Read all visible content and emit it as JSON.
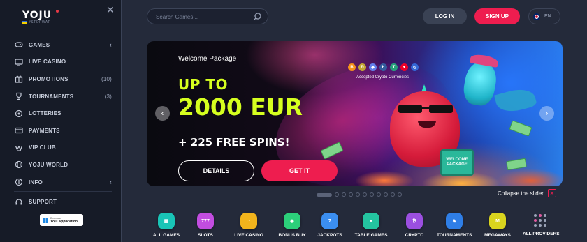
{
  "logo": {
    "name": "YOJU",
    "tagline": "#STOPWAR"
  },
  "sidebar": {
    "items": [
      {
        "label": "GAMES",
        "count": "",
        "chevron": "‹",
        "icon": "games-icon"
      },
      {
        "label": "LIVE CASINO",
        "count": "",
        "chevron": "",
        "icon": "live-casino-icon"
      },
      {
        "label": "PROMOTIONS",
        "count": "(10)",
        "chevron": "",
        "icon": "promotions-icon"
      },
      {
        "label": "TOURNAMENTS",
        "count": "(3)",
        "chevron": "",
        "icon": "tournaments-icon"
      },
      {
        "label": "LOTTERIES",
        "count": "",
        "chevron": "",
        "icon": "lotteries-icon"
      },
      {
        "label": "PAYMENTS",
        "count": "",
        "chevron": "",
        "icon": "payments-icon"
      },
      {
        "label": "VIP CLUB",
        "count": "",
        "chevron": "",
        "icon": "vip-icon"
      },
      {
        "label": "YOJU WORLD",
        "count": "",
        "chevron": "",
        "icon": "world-icon"
      },
      {
        "label": "INFO",
        "count": "",
        "chevron": "‹",
        "icon": "info-icon"
      },
      {
        "label": "SUPPORT",
        "count": "",
        "chevron": "",
        "icon": "support-icon"
      }
    ],
    "app_badge": {
      "line1": "Download",
      "line2": "Yoju Application"
    }
  },
  "header": {
    "search_placeholder": "Search Games...",
    "login_label": "LOG IN",
    "signup_label": "SIGN UP",
    "language": "EN"
  },
  "banner": {
    "welcome": "Welcome Package",
    "up_to": "UP TO",
    "amount": "2000 EUR",
    "free_spins": "+ 225 FREE SPINS!",
    "details_label": "DETAILS",
    "get_it_label": "GET IT",
    "crypto_caption": "Accepted Crypto Currencies",
    "coins": [
      {
        "symbol": "B",
        "color": "#f7931a"
      },
      {
        "symbol": "Ð",
        "color": "#c2a633"
      },
      {
        "symbol": "◆",
        "color": "#627eea"
      },
      {
        "symbol": "Ł",
        "color": "#345d9d"
      },
      {
        "symbol": "T",
        "color": "#26a17b"
      },
      {
        "symbol": "▼",
        "color": "#ef0027"
      },
      {
        "symbol": "◎",
        "color": "#3467d6"
      }
    ],
    "case_text": "WELCOME PACKAGE"
  },
  "slider": {
    "total_slides": 11,
    "active_index": 0,
    "collapse_label": "Collapse the slider"
  },
  "categories": [
    {
      "label": "ALL GAMES",
      "color": "#19c4b6",
      "glyph": "▦"
    },
    {
      "label": "SLOTS",
      "color": "#c24de0",
      "glyph": "777"
    },
    {
      "label": "LIVE CASINO",
      "color": "#f2b41c",
      "glyph": "◔"
    },
    {
      "label": "BONUS BUY",
      "color": "#2ccf7a",
      "glyph": "◆"
    },
    {
      "label": "JACKPOTS",
      "color": "#3b8ef0",
      "glyph": "7"
    },
    {
      "label": "TABLE GAMES",
      "color": "#24c4a0",
      "glyph": "♠"
    },
    {
      "label": "CRYPTO",
      "color": "#9b4fe0",
      "glyph": "₿"
    },
    {
      "label": "TOURNAMENTS",
      "color": "#2f7ee6",
      "glyph": "♞"
    },
    {
      "label": "MEGAWAYS",
      "color": "#d9d41e",
      "glyph": "M"
    },
    {
      "label": "ALL PROVIDERS",
      "color": "",
      "glyph": ""
    }
  ]
}
